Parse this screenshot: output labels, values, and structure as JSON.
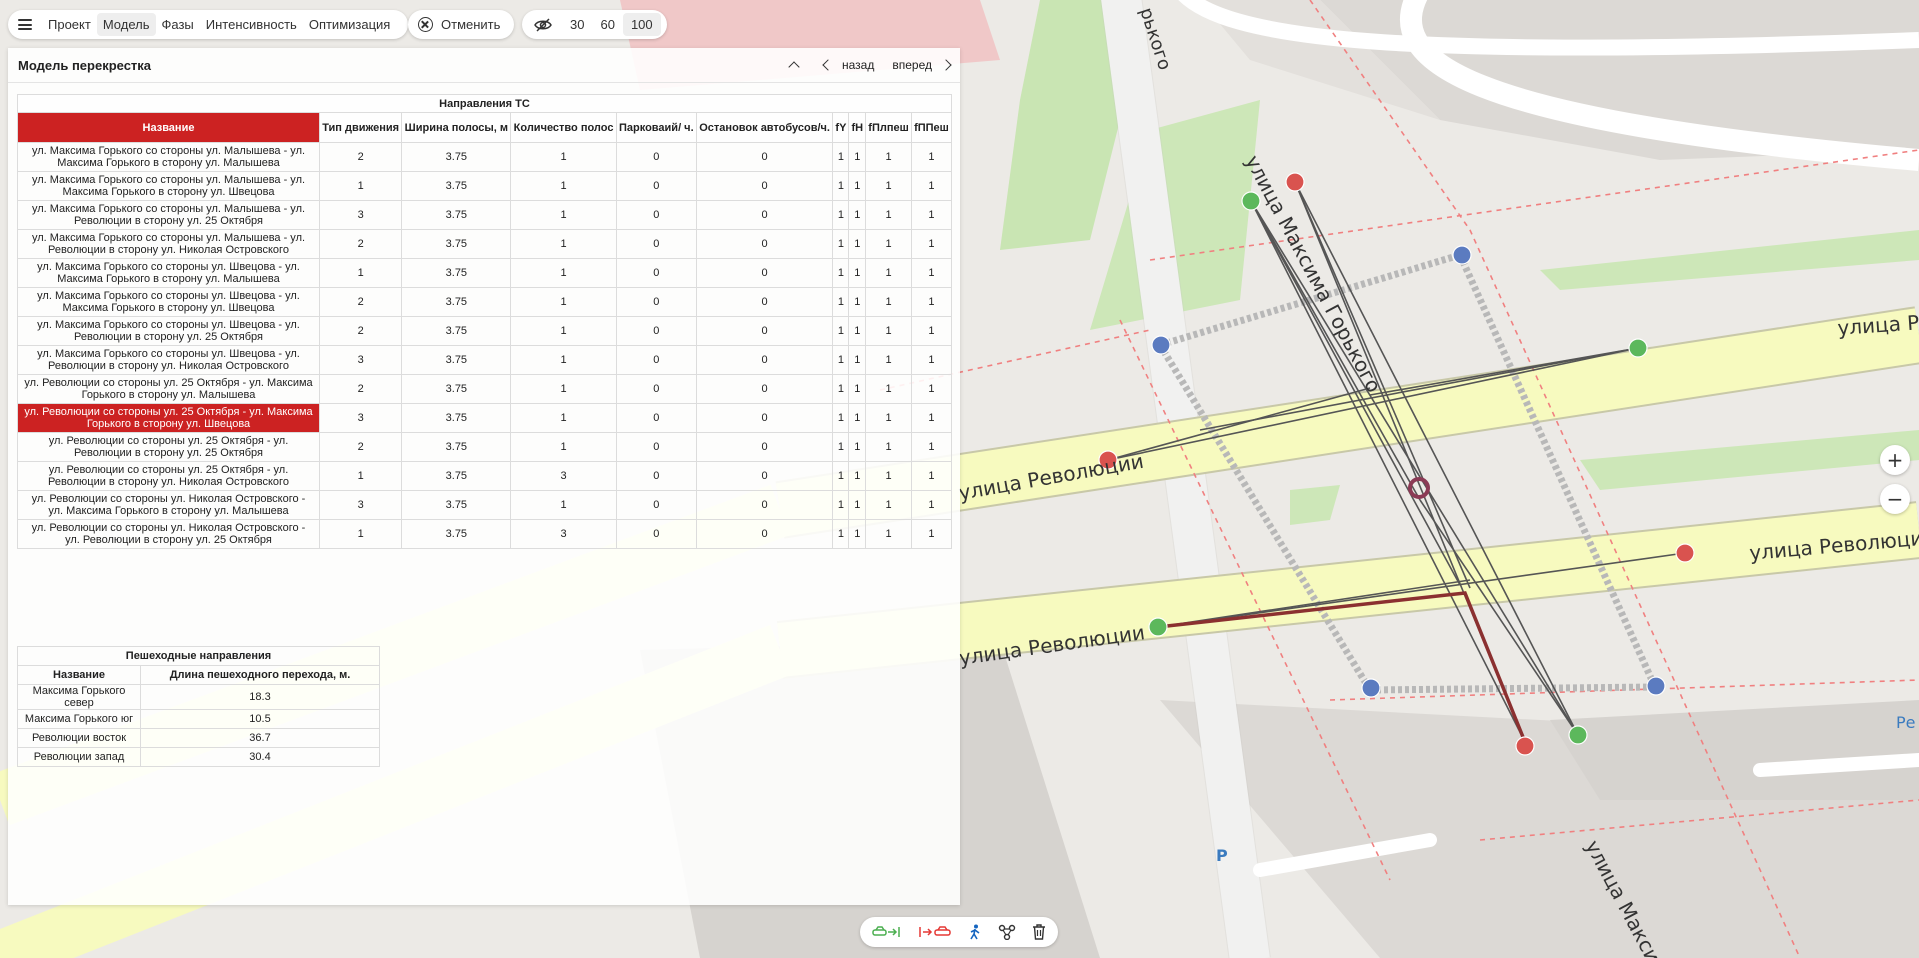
{
  "toolbar": {
    "menu_items": [
      "Проект",
      "Модель",
      "Фазы",
      "Интенсивность",
      "Оптимизация"
    ],
    "active_menu": "Модель",
    "undo_label": "Отменить",
    "scale_options": [
      "30",
      "60",
      "100"
    ],
    "active_scale": "100"
  },
  "panel": {
    "title": "Модель перекрестка",
    "back_label": "назад",
    "forward_label": "вперед"
  },
  "directions": {
    "group_title": "Направления ТС",
    "headers": [
      "Название",
      "Тип движения",
      "Ширина полосы, м",
      "Количество полос",
      "Парковаий/ ч.",
      "Остановок автобусов/ч.",
      "fY",
      "fH",
      "fПлпеш",
      "fППеш"
    ],
    "rows": [
      {
        "name": "ул. Максима Горького со стороны ул. Малышева - ул. Максима Горького в сторону ул. Малышева",
        "type": "2",
        "width": "3.75",
        "lanes": "1",
        "parking": "0",
        "bus": "0",
        "fy": "1",
        "fh": "1",
        "flp": "1",
        "fpp": "1"
      },
      {
        "name": "ул. Максима Горького со стороны ул. Малышева - ул. Максима Горького в сторону ул. Швецова",
        "type": "1",
        "width": "3.75",
        "lanes": "1",
        "parking": "0",
        "bus": "0",
        "fy": "1",
        "fh": "1",
        "flp": "1",
        "fpp": "1"
      },
      {
        "name": "ул. Максима Горького со стороны ул. Малышева - ул. Революции в сторону ул. 25 Октября",
        "type": "3",
        "width": "3.75",
        "lanes": "1",
        "parking": "0",
        "bus": "0",
        "fy": "1",
        "fh": "1",
        "flp": "1",
        "fpp": "1"
      },
      {
        "name": "ул. Максима Горького со стороны ул. Малышева - ул. Революции в сторону ул. Николая Островского",
        "type": "2",
        "width": "3.75",
        "lanes": "1",
        "parking": "0",
        "bus": "0",
        "fy": "1",
        "fh": "1",
        "flp": "1",
        "fpp": "1"
      },
      {
        "name": "ул. Максима Горького со стороны ул. Швецова - ул. Максима Горького в сторону ул. Малышева",
        "type": "1",
        "width": "3.75",
        "lanes": "1",
        "parking": "0",
        "bus": "0",
        "fy": "1",
        "fh": "1",
        "flp": "1",
        "fpp": "1"
      },
      {
        "name": "ул. Максима Горького со стороны ул. Швецова - ул. Максима Горького в сторону ул. Швецова",
        "type": "2",
        "width": "3.75",
        "lanes": "1",
        "parking": "0",
        "bus": "0",
        "fy": "1",
        "fh": "1",
        "flp": "1",
        "fpp": "1"
      },
      {
        "name": "ул. Максима Горького со стороны ул. Швецова - ул. Революции в сторону ул. 25 Октября",
        "type": "2",
        "width": "3.75",
        "lanes": "1",
        "parking": "0",
        "bus": "0",
        "fy": "1",
        "fh": "1",
        "flp": "1",
        "fpp": "1"
      },
      {
        "name": "ул. Максима Горького со стороны ул. Швецова - ул. Революции в сторону ул. Николая Островского",
        "type": "3",
        "width": "3.75",
        "lanes": "1",
        "parking": "0",
        "bus": "0",
        "fy": "1",
        "fh": "1",
        "flp": "1",
        "fpp": "1"
      },
      {
        "name": "ул. Революции со стороны ул. 25 Октября - ул. Максима Горького в сторону ул. Малышева",
        "type": "2",
        "width": "3.75",
        "lanes": "1",
        "parking": "0",
        "bus": "0",
        "fy": "1",
        "fh": "1",
        "flp": "1",
        "fpp": "1"
      },
      {
        "name": "ул. Революции со стороны ул. 25 Октября - ул. Максима Горького в сторону ул. Швецова",
        "type": "3",
        "width": "3.75",
        "lanes": "1",
        "parking": "0",
        "bus": "0",
        "fy": "1",
        "fh": "1",
        "flp": "1",
        "fpp": "1"
      },
      {
        "name": "ул. Революции со стороны ул. 25 Октября - ул. Революции в сторону ул. 25 Октября",
        "type": "2",
        "width": "3.75",
        "lanes": "1",
        "parking": "0",
        "bus": "0",
        "fy": "1",
        "fh": "1",
        "flp": "1",
        "fpp": "1"
      },
      {
        "name": "ул. Революции со стороны ул. 25 Октября - ул. Революции в сторону ул. Николая Островского",
        "type": "1",
        "width": "3.75",
        "lanes": "3",
        "parking": "0",
        "bus": "0",
        "fy": "1",
        "fh": "1",
        "flp": "1",
        "fpp": "1"
      },
      {
        "name": "ул. Революции со стороны ул. Николая Островского - ул. Максима Горького в сторону ул. Малышева",
        "type": "3",
        "width": "3.75",
        "lanes": "1",
        "parking": "0",
        "bus": "0",
        "fy": "1",
        "fh": "1",
        "flp": "1",
        "fpp": "1"
      },
      {
        "name": "ул. Революции со стороны ул. Николая Островского - ул. Революции в сторону ул. 25 Октября",
        "type": "1",
        "width": "3.75",
        "lanes": "3",
        "parking": "0",
        "bus": "0",
        "fy": "1",
        "fh": "1",
        "flp": "1",
        "fpp": "1"
      }
    ],
    "selected_row": 9
  },
  "pedestrian": {
    "group_title": "Пешеходные направления",
    "headers": [
      "Название",
      "Длина пешеходного перехода, м."
    ],
    "rows": [
      {
        "name": "Максима Горького север",
        "length": "18.3"
      },
      {
        "name": "Максима Горького юг",
        "length": "10.5"
      },
      {
        "name": "Революции восток",
        "length": "36.7"
      },
      {
        "name": "Революции запад",
        "length": "30.4"
      }
    ]
  },
  "map": {
    "street_labels": [
      "улица Максима Горького",
      "улица Революции",
      "улица Революции",
      "улица Революции",
      "улица Макси",
      "рького",
      "улица Р",
      "Ре"
    ],
    "parking_label": "Р",
    "colors": {
      "primary_road": "#f7fabf",
      "selection": "#cc2222",
      "point_green": "#5cb85c",
      "point_red": "#d9534f",
      "point_blue": "#5b7bc0"
    }
  },
  "zoom": {
    "in": "+",
    "out": "−"
  }
}
